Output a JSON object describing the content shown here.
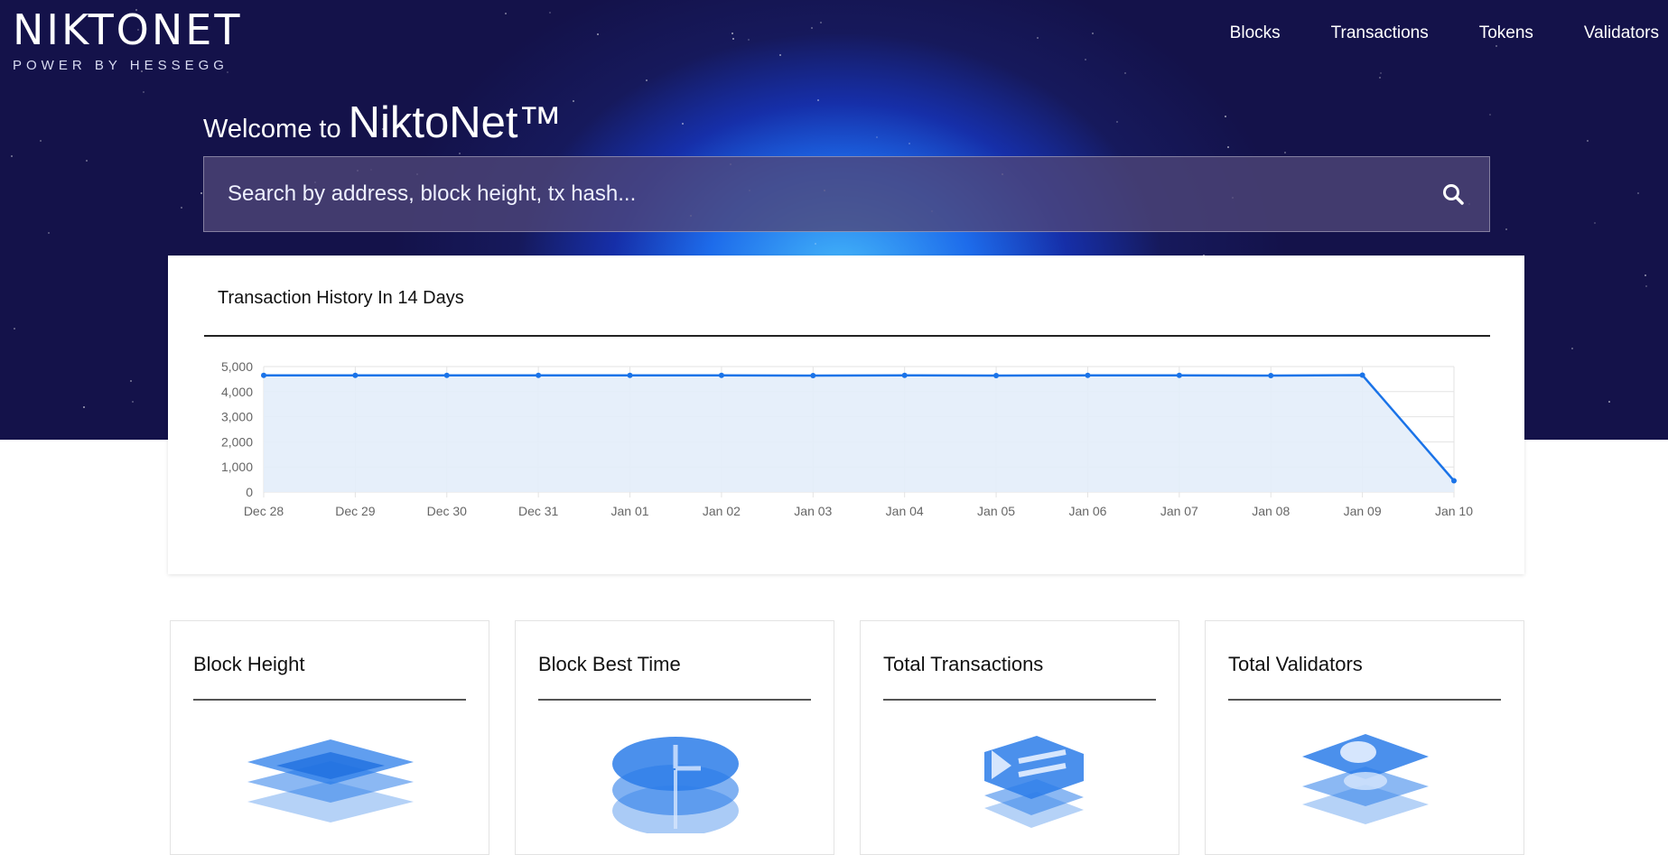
{
  "header": {
    "logo_main": "NIKTONET",
    "logo_sub": "POWER BY HESSEGG",
    "nav": [
      "Blocks",
      "Transactions",
      "Tokens",
      "Validators"
    ]
  },
  "hero": {
    "welcome_prefix": "Welcome to",
    "welcome_brand": "NiktoNet™",
    "search_placeholder": "Search by address, block height, tx hash..."
  },
  "chart_card": {
    "title": "Transaction History In 14 Days"
  },
  "chart_data": {
    "type": "area",
    "categories": [
      "Dec 28",
      "Dec 29",
      "Dec 30",
      "Dec 31",
      "Jan 01",
      "Jan 02",
      "Jan 03",
      "Jan 04",
      "Jan 05",
      "Jan 06",
      "Jan 07",
      "Jan 08",
      "Jan 09",
      "Jan 10"
    ],
    "values": [
      4650,
      4650,
      4650,
      4650,
      4650,
      4650,
      4640,
      4650,
      4640,
      4650,
      4650,
      4640,
      4660,
      450
    ],
    "ylim": [
      0,
      5000
    ],
    "yticks": [
      0,
      1000,
      2000,
      3000,
      4000,
      5000
    ],
    "grid": true,
    "colors": {
      "line": "#1a73e8",
      "fill": "#e3edfa",
      "grid": "#e3e3e3",
      "tick": "#666666"
    }
  },
  "stats": [
    {
      "title": "Block Height",
      "icon": "layers-icon"
    },
    {
      "title": "Block Best Time",
      "icon": "clock-icon"
    },
    {
      "title": "Total Transactions",
      "icon": "documents-icon"
    },
    {
      "title": "Total Validators",
      "icon": "validators-icon"
    }
  ],
  "colors": {
    "accent": "#2b7de9",
    "hero_bg": "#14124a"
  }
}
